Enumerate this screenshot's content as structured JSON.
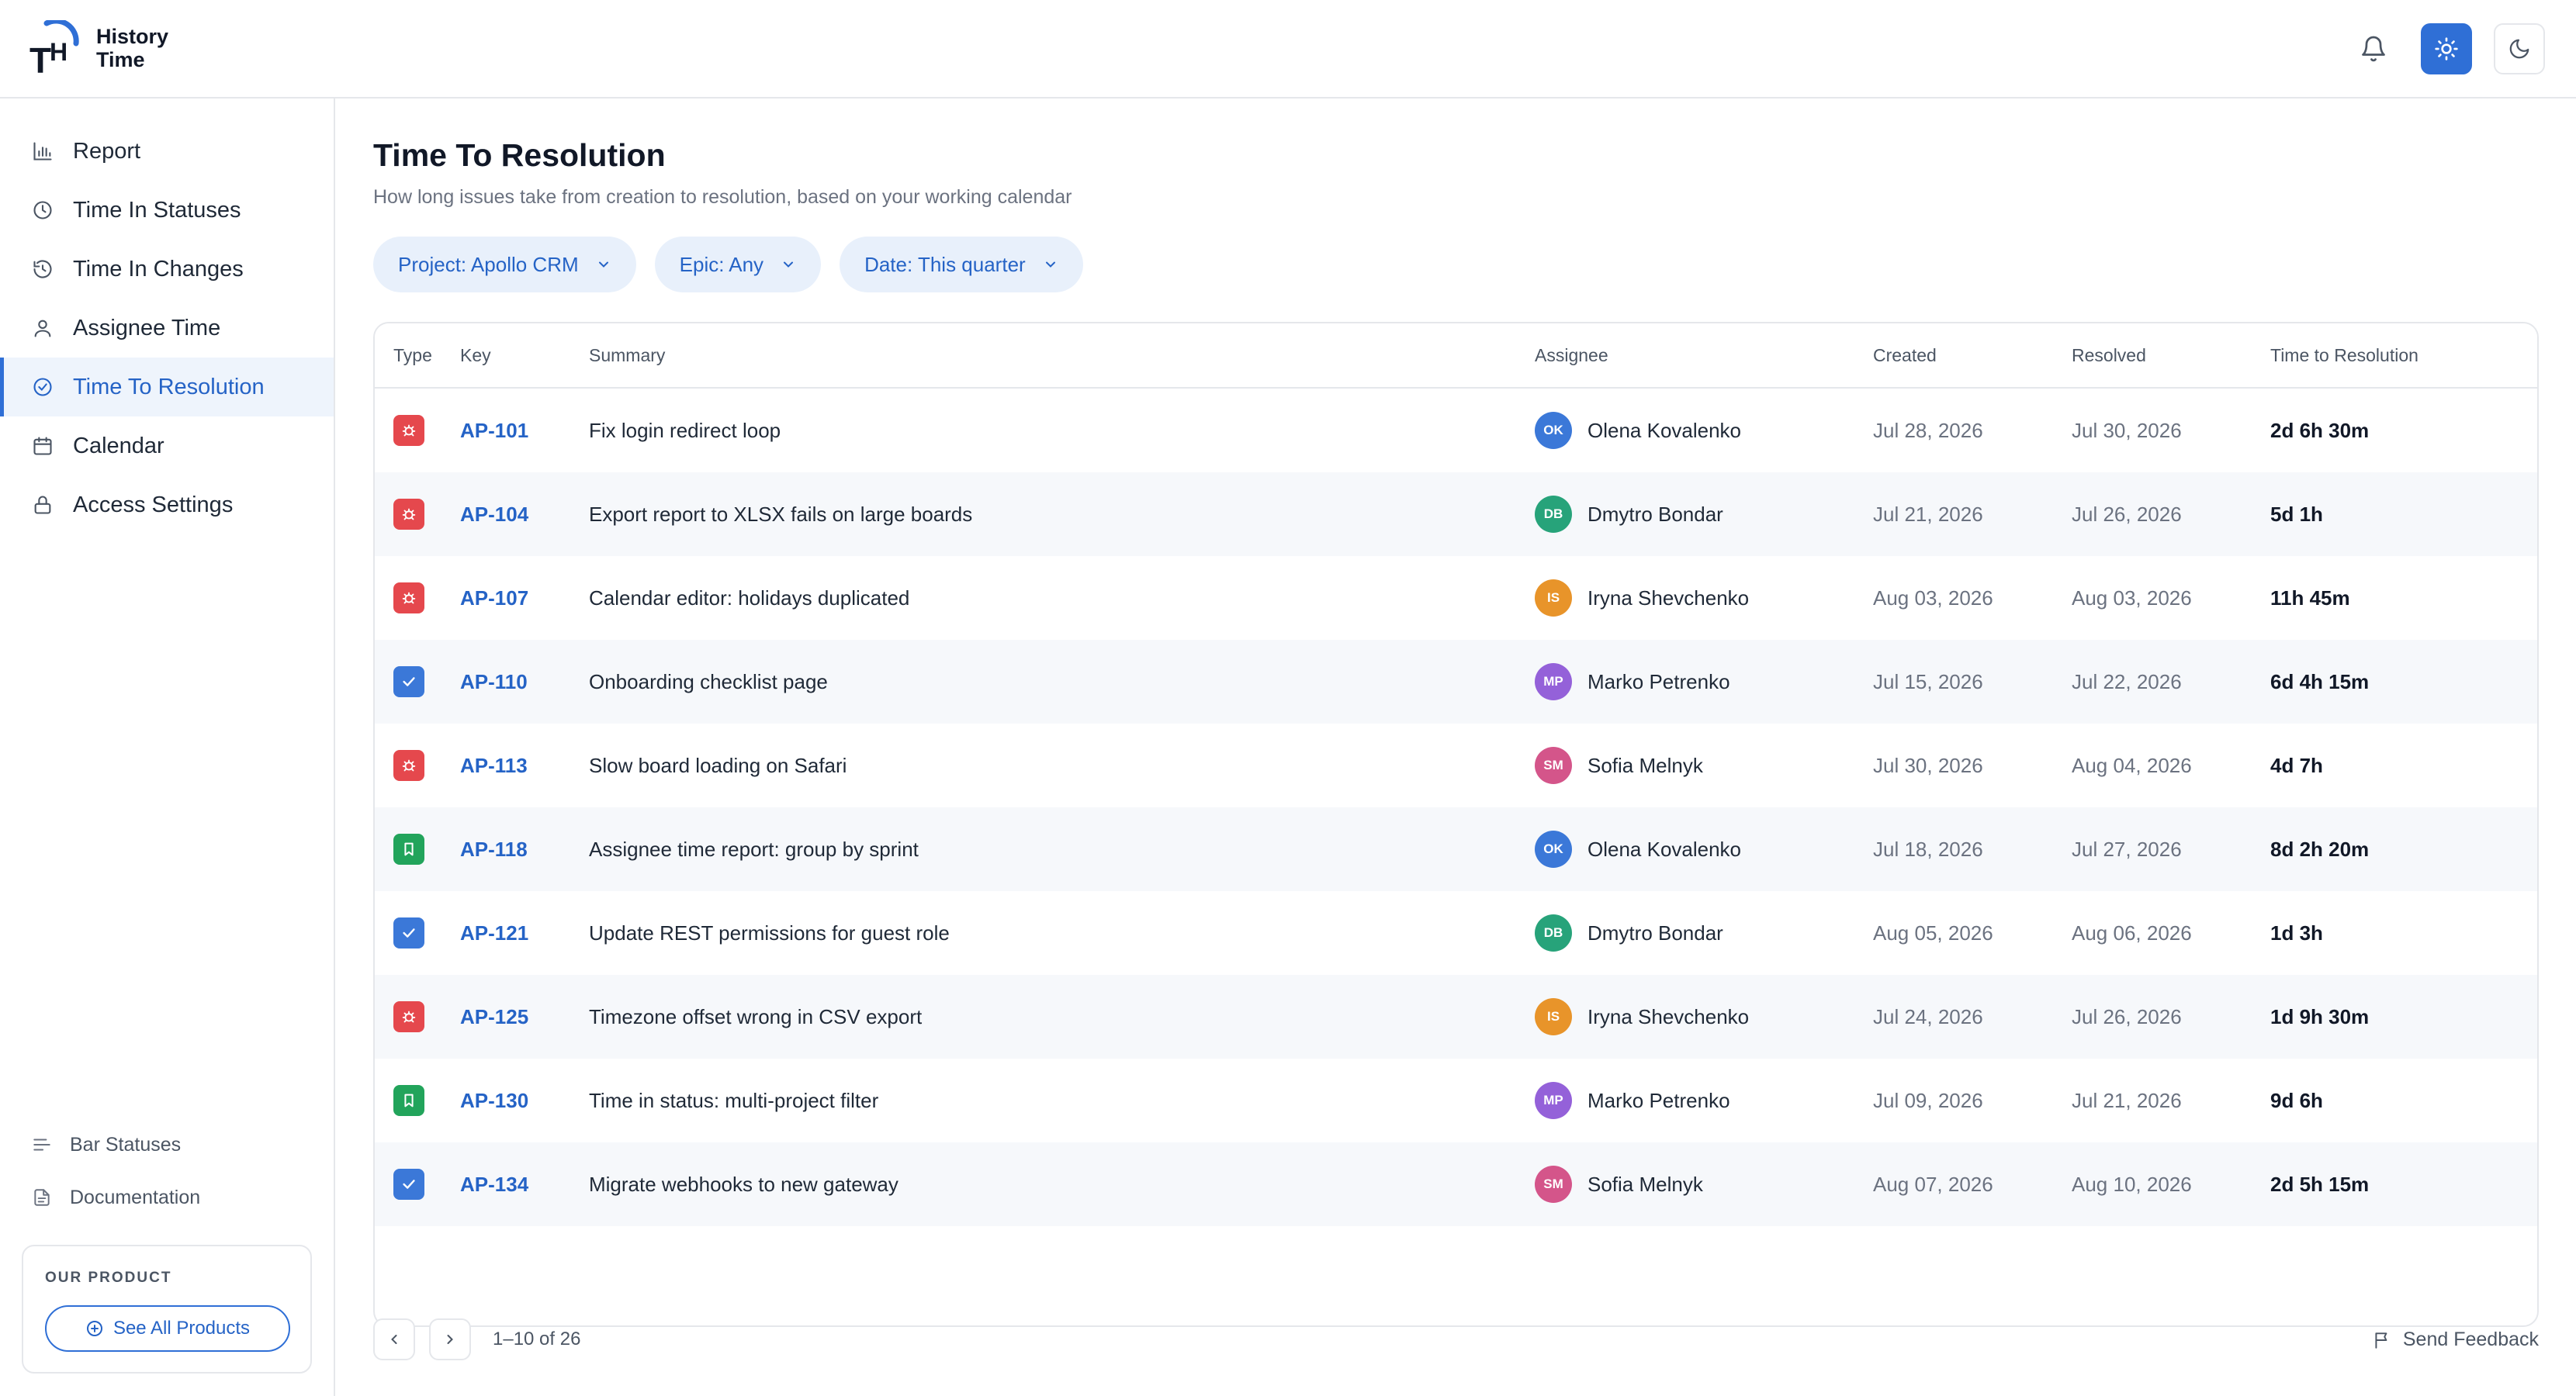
{
  "app": {
    "brand_line1": "History",
    "brand_line2": "Time",
    "accent_color": "#2f6fd6"
  },
  "topbar": {
    "icons": [
      "bell-icon",
      "sun-icon",
      "moon-icon"
    ],
    "active_theme": "light"
  },
  "sidebar": {
    "items": [
      {
        "label": "Report",
        "icon": "bar-chart-icon"
      },
      {
        "label": "Time In Statuses",
        "icon": "clock-icon"
      },
      {
        "label": "Time In Changes",
        "icon": "history-icon"
      },
      {
        "label": "Assignee Time",
        "icon": "user-icon"
      },
      {
        "label": "Time To Resolution",
        "icon": "check-circle-icon",
        "active": true
      },
      {
        "label": "Calendar",
        "icon": "calendar-icon"
      },
      {
        "label": "Access Settings",
        "icon": "lock-icon"
      }
    ],
    "bottom_items": [
      {
        "label": "Bar Statuses",
        "icon": "bars-icon"
      },
      {
        "label": "Documentation",
        "icon": "document-icon"
      }
    ],
    "product": {
      "label": "OUR PRODUCT",
      "button": "See All Products"
    }
  },
  "main": {
    "title": "Time To Resolution",
    "subtitle": "How long issues take from creation to resolution, based on your working calendar",
    "filters": [
      {
        "label": "Project: Apollo CRM"
      },
      {
        "label": "Epic: Any"
      },
      {
        "label": "Date: This quarter"
      }
    ],
    "table": {
      "headers": {
        "type": "Type",
        "key": "Key",
        "summary": "Summary",
        "assignee": "Assignee",
        "created": "Created",
        "resolved": "Resolved",
        "ttr": "Time to Resolution"
      },
      "rows": [
        {
          "type": "bug",
          "key": "AP-101",
          "summary": "Fix login redirect loop",
          "initials": "OK",
          "assignee": "Olena Kovalenko",
          "avatar_color": "#3b78d8",
          "created": "Jul 28, 2026",
          "resolved": "Jul 30, 2026",
          "ttr": "2d 6h 30m"
        },
        {
          "type": "bug",
          "key": "AP-104",
          "summary": "Export report to XLSX fails on large boards",
          "initials": "DB",
          "assignee": "Dmytro Bondar",
          "avatar_color": "#27a37a",
          "created": "Jul 21, 2026",
          "resolved": "Jul 26, 2026",
          "ttr": "5d 1h"
        },
        {
          "type": "bug",
          "key": "AP-107",
          "summary": "Calendar editor: holidays duplicated",
          "initials": "IS",
          "assignee": "Iryna Shevchenko",
          "avatar_color": "#e8942a",
          "created": "Aug 03, 2026",
          "resolved": "Aug 03, 2026",
          "ttr": "11h 45m"
        },
        {
          "type": "task",
          "key": "AP-110",
          "summary": "Onboarding checklist page",
          "initials": "MP",
          "assignee": "Marko Petrenko",
          "avatar_color": "#9461d9",
          "created": "Jul 15, 2026",
          "resolved": "Jul 22, 2026",
          "ttr": "6d 4h 15m"
        },
        {
          "type": "bug",
          "key": "AP-113",
          "summary": "Slow board loading on Safari",
          "initials": "SM",
          "assignee": "Sofia Melnyk",
          "avatar_color": "#d4558a",
          "created": "Jul 30, 2026",
          "resolved": "Aug 04, 2026",
          "ttr": "4d 7h"
        },
        {
          "type": "story",
          "key": "AP-118",
          "summary": "Assignee time report: group by sprint",
          "initials": "OK",
          "assignee": "Olena Kovalenko",
          "avatar_color": "#3b78d8",
          "created": "Jul 18, 2026",
          "resolved": "Jul 27, 2026",
          "ttr": "8d 2h 20m"
        },
        {
          "type": "task",
          "key": "AP-121",
          "summary": "Update REST permissions for guest role",
          "initials": "DB",
          "assignee": "Dmytro Bondar",
          "avatar_color": "#27a37a",
          "created": "Aug 05, 2026",
          "resolved": "Aug 06, 2026",
          "ttr": "1d 3h"
        },
        {
          "type": "bug",
          "key": "AP-125",
          "summary": "Timezone offset wrong in CSV export",
          "initials": "IS",
          "assignee": "Iryna Shevchenko",
          "avatar_color": "#e8942a",
          "created": "Jul 24, 2026",
          "resolved": "Jul 26, 2026",
          "ttr": "1d 9h 30m"
        },
        {
          "type": "story",
          "key": "AP-130",
          "summary": "Time in status: multi-project filter",
          "initials": "MP",
          "assignee": "Marko Petrenko",
          "avatar_color": "#9461d9",
          "created": "Jul 09, 2026",
          "resolved": "Jul 21, 2026",
          "ttr": "9d 6h"
        },
        {
          "type": "task",
          "key": "AP-134",
          "summary": "Migrate webhooks to new gateway",
          "initials": "SM",
          "assignee": "Sofia Melnyk",
          "avatar_color": "#d4558a",
          "created": "Aug 07, 2026",
          "resolved": "Aug 10, 2026",
          "ttr": "2d 5h 15m"
        }
      ]
    },
    "pagination": {
      "text": "1–10 of 26"
    },
    "feedback": {
      "label": "Send Feedback"
    }
  }
}
